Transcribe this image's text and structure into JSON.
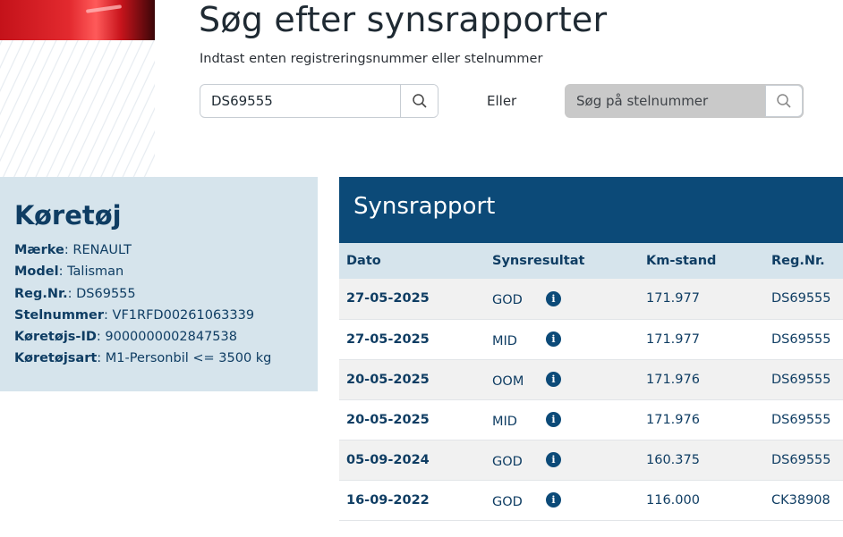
{
  "search": {
    "title": "Søg efter synsrapporter",
    "subtitle": "Indtast enten registreringsnummer eller stelnummer",
    "reg_value": "DS69555",
    "or_label": "Eller",
    "vin_placeholder": "Søg på stelnummer"
  },
  "vehicle": {
    "heading": "Køretøj",
    "fields": [
      {
        "label": "Mærke",
        "value": "RENAULT"
      },
      {
        "label": "Model",
        "value": "Talisman"
      },
      {
        "label": "Reg.Nr.",
        "value": "DS69555"
      },
      {
        "label": "Stelnummer",
        "value": "VF1RFD00261063339"
      },
      {
        "label": "Køretøjs-ID",
        "value": "9000000002847538"
      },
      {
        "label": "Køretøjsart",
        "value": "M1-Personbil <= 3500 kg"
      }
    ]
  },
  "report": {
    "heading": "Synsrapport",
    "columns": [
      "Dato",
      "Synsresultat",
      "Km-stand",
      "Reg.Nr."
    ],
    "rows": [
      {
        "date": "27-05-2025",
        "result": "GOD",
        "km": "171.977",
        "reg": "DS69555"
      },
      {
        "date": "27-05-2025",
        "result": "MID",
        "km": "171.977",
        "reg": "DS69555"
      },
      {
        "date": "20-05-2025",
        "result": "OOM",
        "km": "171.976",
        "reg": "DS69555"
      },
      {
        "date": "20-05-2025",
        "result": "MID",
        "km": "171.976",
        "reg": "DS69555"
      },
      {
        "date": "05-09-2024",
        "result": "GOD",
        "km": "160.375",
        "reg": "DS69555"
      },
      {
        "date": "16-09-2022",
        "result": "GOD",
        "km": "116.000",
        "reg": "CK38908"
      }
    ],
    "info_icon_glyph": "i"
  },
  "icons": {
    "search": "search-icon",
    "info": "info-icon"
  },
  "colors": {
    "primary": "#0c4a78",
    "panel": "#d6e4ec",
    "text": "#0f3d63"
  }
}
